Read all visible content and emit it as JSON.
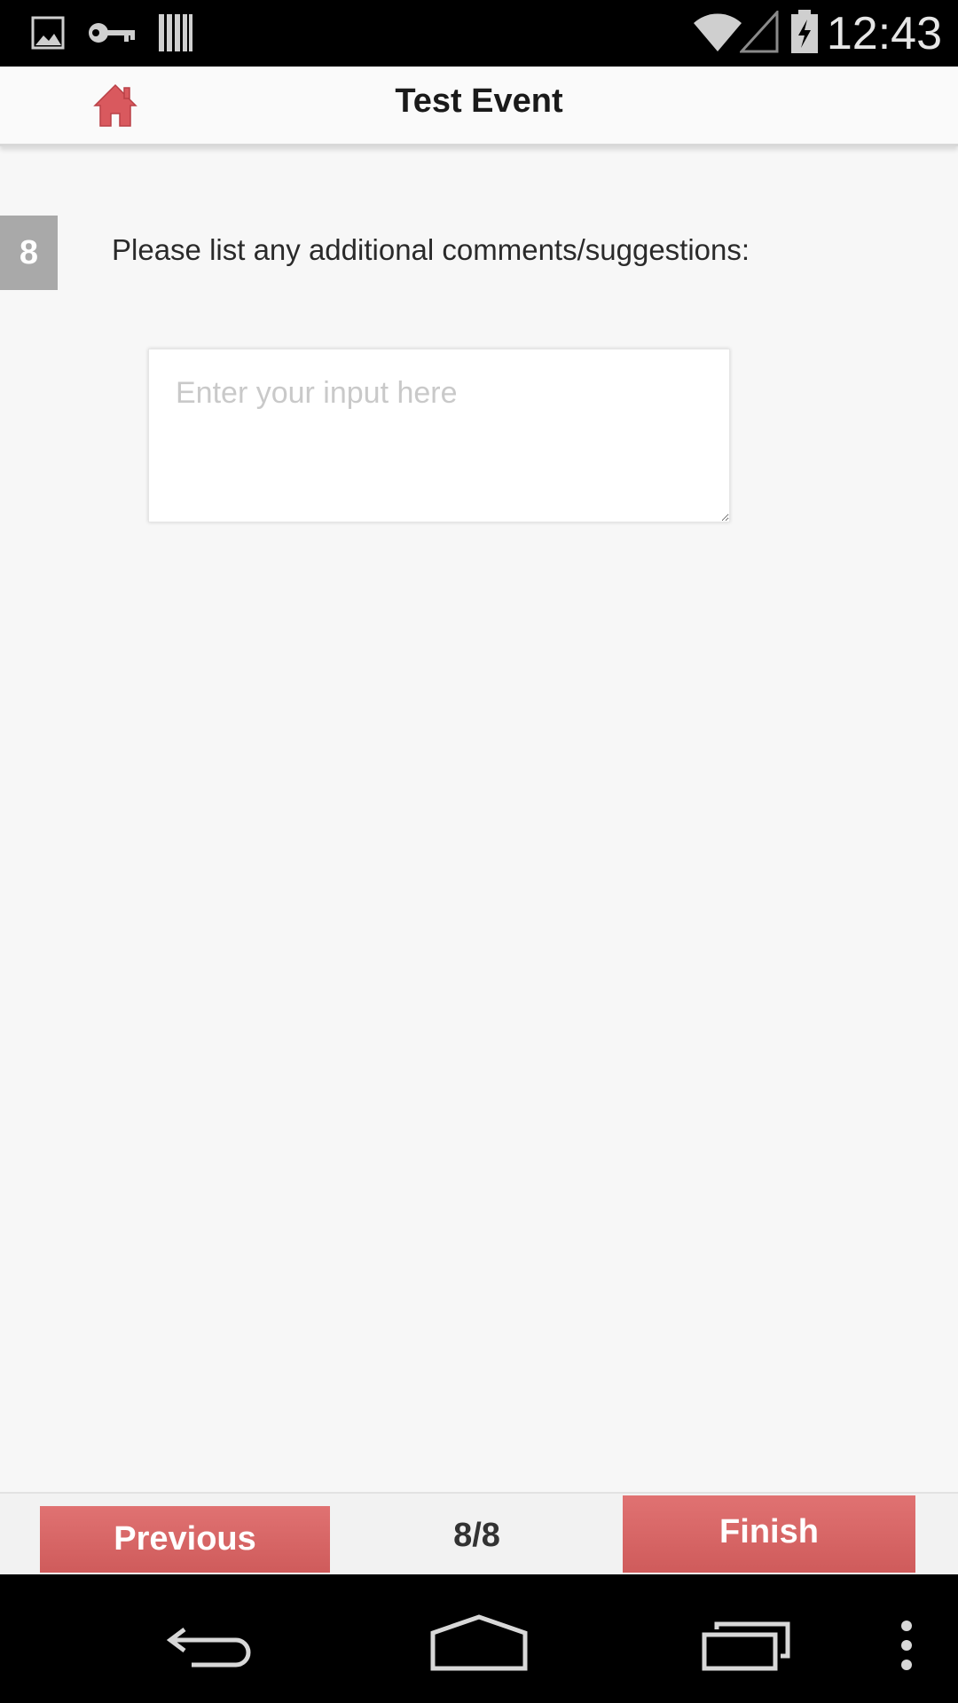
{
  "status_bar": {
    "time": "12:43",
    "left_icons": [
      "image-icon",
      "key-icon",
      "barcode-icon"
    ],
    "right_icons": [
      "wifi-icon",
      "signal-icon",
      "battery-charging-icon"
    ]
  },
  "header": {
    "title": "Test Event",
    "home_icon": "home-icon"
  },
  "question": {
    "number": "8",
    "text": "Please list any additional comments/suggestions:",
    "input_placeholder": "Enter your input here",
    "input_value": ""
  },
  "footer": {
    "previous_label": "Previous",
    "page_indicator": "8/8",
    "finish_label": "Finish"
  },
  "nav_bar": {
    "icons": [
      "back-icon",
      "home-nav-icon",
      "recents-icon",
      "overflow-menu-icon"
    ]
  },
  "colors": {
    "accent": "#d96464",
    "badge": "#a9a9a9",
    "background": "#f7f7f7"
  }
}
